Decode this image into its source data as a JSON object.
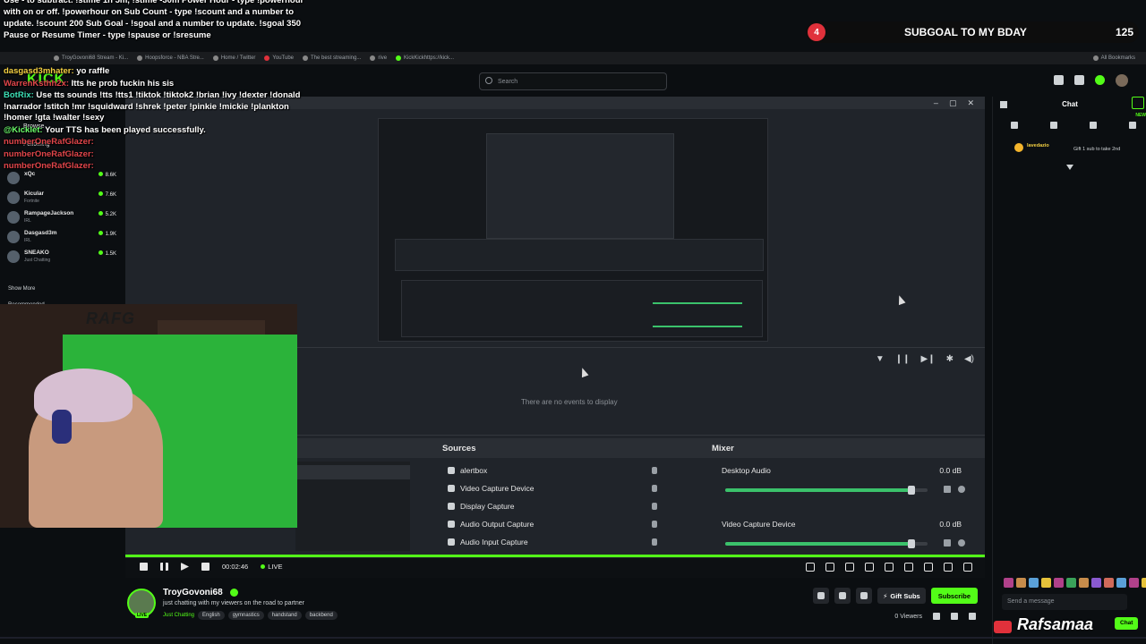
{
  "overlay": {
    "commands_text": "Use - to subtract. !stime 1h 5m, !stime -30m Power Hour - type !powerhour with on or off. !powerhour on Sub Count - type !scount and a number to update. !scount 200 Sub Goal - !sgoal and a number to update. !sgoal 350 Pause or Resume Timer - type !spause or !sresume",
    "chat_lines": [
      {
        "user": "dasgasd3mhater:",
        "text": "yo raffle",
        "color": "gold"
      },
      {
        "user": "WarrenKsthh2x:",
        "text": "Itts he prob fuckin his sis",
        "color": "red"
      },
      {
        "user": "BotRix:",
        "text": "Use tts sounds !tts !tts1 !tiktok !tiktok2 !brian !ivy !dexter !donald !narrador !stitch !mr !squidward !shrek !peter !pinkie !mickie !plankton !homer !gta !walter !sexy",
        "color": "teal"
      },
      {
        "user": "@Kicklet:",
        "text": "Your TTS has been played successfully.",
        "color": "green"
      },
      {
        "user": "numberOneRafGlazer:",
        "text": "",
        "color": "red"
      },
      {
        "user": "numberOneRafGlazer:",
        "text": "",
        "color": "red"
      },
      {
        "user": "numberOneRafGlazer:",
        "text": "",
        "color": "red"
      }
    ]
  },
  "subgoal": {
    "count": "4",
    "title": "SUBGOAL TO MY BDAY",
    "goal": "125"
  },
  "bookmarks": {
    "items": [
      "TroyGovoni68 Stream - Ki...",
      "Hoopsforce - NBA Stre...",
      "Home / Twitter",
      "YouTube",
      "The best streaming...",
      "rive",
      "KickKickhttps://kick..."
    ],
    "all_label": "All Bookmarks"
  },
  "header": {
    "logo": "KICK",
    "search_placeholder": "Search"
  },
  "sidebar": {
    "browse": "Browse",
    "following": "Following",
    "channels": [
      {
        "name": "xQc",
        "category": "",
        "viewers": "8.6K"
      },
      {
        "name": "Kicular",
        "category": "Fortnite",
        "viewers": "7.6K"
      },
      {
        "name": "RampageJackson",
        "category": "IRL",
        "viewers": "5.2K"
      },
      {
        "name": "Dasgasd3m",
        "category": "IRL",
        "viewers": "1.9K"
      },
      {
        "name": "SNEAKO",
        "category": "Just Chatting",
        "viewers": "1.5K"
      }
    ],
    "show_more": "Show More",
    "recommended": "Recommended"
  },
  "obs": {
    "no_events": "There are no events to display",
    "sources_title": "Sources",
    "mixer_title": "Mixer",
    "sources": [
      "alertbox",
      "Video Capture Device",
      "Display Capture",
      "Audio Output Capture",
      "Audio Input Capture"
    ],
    "mixer": [
      {
        "name": "Desktop Audio",
        "db": "0.0 dB",
        "level": 0.92
      },
      {
        "name": "Video Capture Device",
        "db": "0.0 dB",
        "level": 0.92
      }
    ]
  },
  "webcam": {
    "logo_text": "RAFG"
  },
  "player": {
    "time": "00:02:46",
    "live": "LIVE"
  },
  "channel": {
    "name": "TroyGovoni68",
    "live_badge": "LIVE",
    "title": "just chatting with my viewers on the road to partner",
    "category": "Just Chatting",
    "tags": [
      "English",
      "gymnastics",
      "handstand",
      "backbend"
    ],
    "gift_label": "Gift Subs",
    "subscribe_label": "Subscribe",
    "viewers": "0 Viewers"
  },
  "chat": {
    "header": "Chat",
    "new_label": "NEW",
    "message_user": "lavedazio",
    "message_text": "Gift 1 sub to take 2nd",
    "input_placeholder": "Send a message",
    "send_label": "Chat",
    "watermark": "Rafsamaa"
  },
  "colors": {
    "kick_green": "#53fc18",
    "subgoal_red": "#e0313b",
    "greenscreen": "#2bb33a"
  }
}
